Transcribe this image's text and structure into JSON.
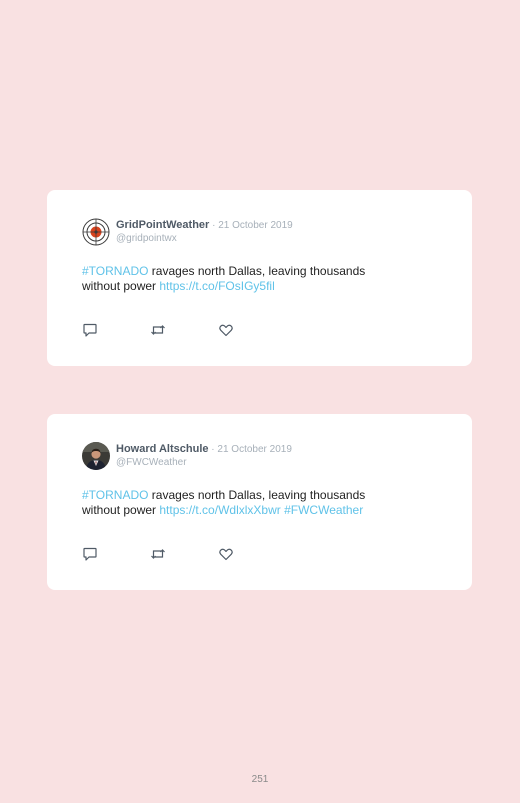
{
  "tweets": [
    {
      "author": "GridPointWeather",
      "date": "21 October 2019",
      "handle": "@gridpointwx",
      "text": {
        "hashtag": "#TORNADO",
        "body_line1": " ravages north Dallas, leaving thousands",
        "body_line2": "without power ",
        "link": "https://t.co/FOsIGy5fil",
        "extra": ""
      },
      "avatar_icon": "target-icon"
    },
    {
      "author": "Howard Altschule",
      "date": "21 October 2019",
      "handle": "@FWCWeather",
      "text": {
        "hashtag": "#TORNADO",
        "body_line1": " ravages north Dallas, leaving thousands",
        "body_line2": "without power ",
        "link": "https://t.co/WdlxlxXbwr",
        "extra": " #FWCWeather"
      },
      "avatar_icon": "profile-photo"
    }
  ],
  "date_separator": " · ",
  "page": {
    "number": "251"
  },
  "colors": {
    "background": "#f9e1e2",
    "card": "#ffffff",
    "link": "#5fc2e8",
    "author": "#4f5a66",
    "muted": "#a7b0b9"
  }
}
